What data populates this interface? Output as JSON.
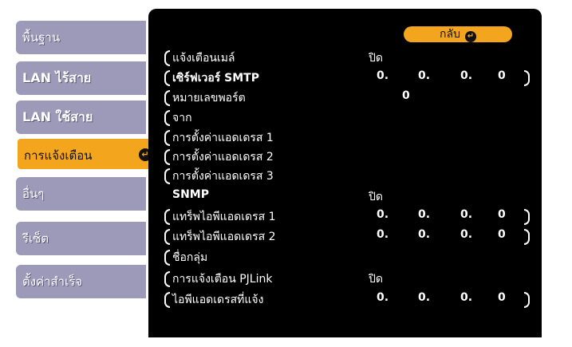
{
  "menu": {
    "items": [
      {
        "label": "พื้นฐาน"
      },
      {
        "label": "LAN ไร้สาย"
      },
      {
        "label": "LAN ใช้สาย"
      },
      {
        "label": "การแจ้งเตือน"
      },
      {
        "label": "อื่นๆ"
      },
      {
        "label": "รีเซ็ต"
      },
      {
        "label": "ตั้งค่าสำเร็จ"
      }
    ],
    "active_index": 3
  },
  "back_button": {
    "label": "กลับ",
    "icon": "enter-arrow-icon"
  },
  "settings": {
    "mail_notification": {
      "label": "แจ้งเตือนเมล์",
      "value": "ปิด"
    },
    "smtp_server": {
      "label": "เซิร์ฟเวอร์ SMTP",
      "octets": [
        "0.",
        "0.",
        "0.",
        "0"
      ]
    },
    "port_number": {
      "label": "หมายเลขพอร์ต",
      "value": "0"
    },
    "from": {
      "label": "จาก"
    },
    "address1": {
      "label": "การตั้งค่าแอดเดรส 1"
    },
    "address2": {
      "label": "การตั้งค่าแอดเดรส 2"
    },
    "address3": {
      "label": "การตั้งค่าแอดเดรส 3"
    },
    "snmp": {
      "label": "SNMP",
      "value": "ปิด"
    },
    "trap_ip1": {
      "label": "แทร็พไอพีแอดเดรส 1",
      "octets": [
        "0.",
        "0.",
        "0.",
        "0"
      ]
    },
    "trap_ip2": {
      "label": "แทร็พไอพีแอดเดรส 2",
      "octets": [
        "0.",
        "0.",
        "0.",
        "0"
      ]
    },
    "community": {
      "label": "ชื่อกลุ่ม"
    },
    "pjlink_notification": {
      "label": "การแจ้งเตือน PJLink",
      "value": "ปิด"
    },
    "notify_ip": {
      "label": "ไอพีแอดเดรสที่แจ้ง",
      "octets": [
        "0.",
        "0.",
        "0.",
        "0"
      ]
    }
  },
  "colors": {
    "accent": "#f3a51d",
    "menu_bg": "#9c9ab8",
    "panel_bg": "#000000"
  }
}
